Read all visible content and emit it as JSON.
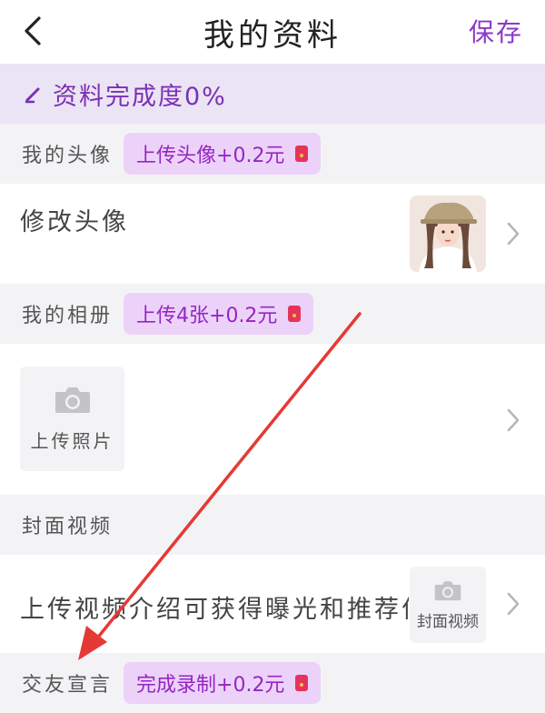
{
  "header": {
    "title": "我的资料",
    "save_label": "保存"
  },
  "progress": {
    "text": "资料完成度0%",
    "percent": 0
  },
  "avatar_section": {
    "label": "我的头像",
    "reward": "上传头像+0.2元",
    "row_label": "修改头像"
  },
  "album_section": {
    "label": "我的相册",
    "reward": "上传4张+0.2元",
    "upload_label": "上传照片"
  },
  "video_section": {
    "label": "封面视频",
    "row_label": "上传视频介绍可获得曝光和推荐位",
    "tile_label": "封面视频"
  },
  "declaration_section": {
    "label": "交友宣言",
    "reward": "完成录制+0.2元"
  },
  "colors": {
    "accent": "#8a39c7",
    "banner_bg": "#ebe4f4",
    "badge_bg": "#ecd2f8",
    "annotation_arrow": "#e53935"
  }
}
